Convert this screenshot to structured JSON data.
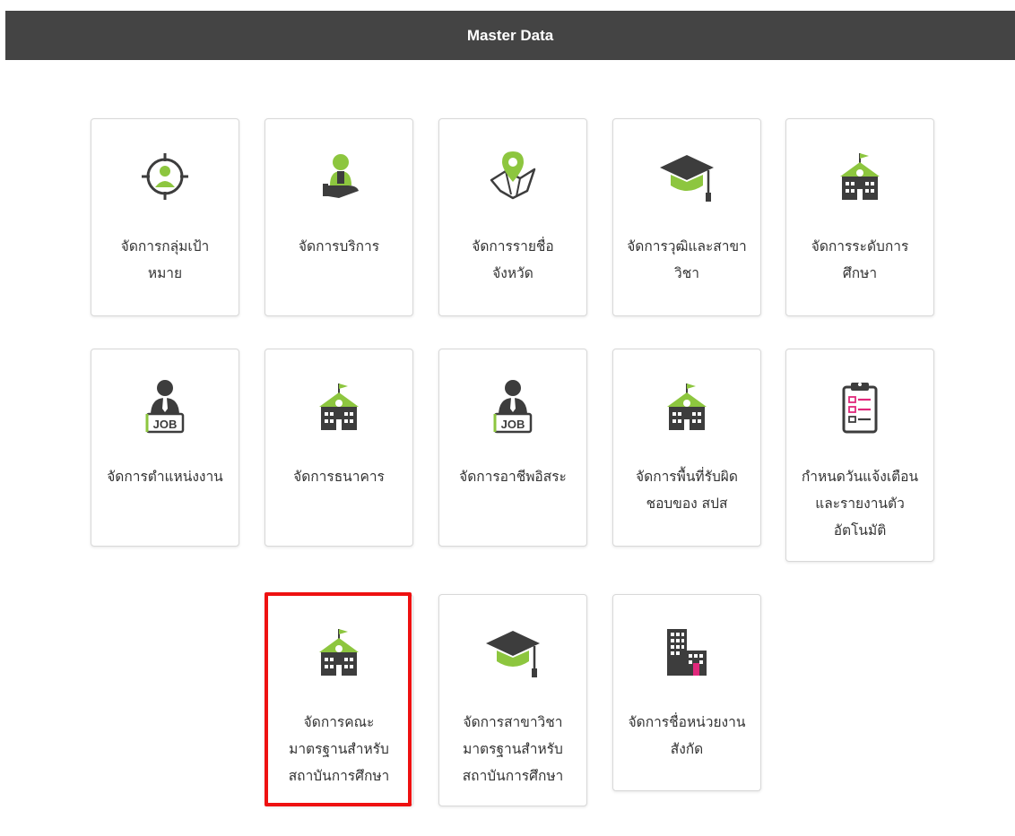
{
  "header": {
    "title": "Master Data"
  },
  "colors": {
    "accent": "#8dc63f",
    "header_bg": "#444444",
    "highlight": "#ee1111",
    "icon_dark": "#3d3d3d",
    "icon_pink": "#e0287b"
  },
  "cards": [
    {
      "label": "จัดการกลุ่มเป้า\nหมาย",
      "icon": "target-person-icon"
    },
    {
      "label": "จัดการบริการ",
      "icon": "service-person-icon"
    },
    {
      "label": "จัดการรายชื่อ\nจังหวัด",
      "icon": "map-pin-icon"
    },
    {
      "label": "จัดการวุฒิและสาขา\nวิชา",
      "icon": "graduation-cap-icon"
    },
    {
      "label": "จัดการระดับการ\nศึกษา",
      "icon": "school-building-icon"
    },
    {
      "label": "จัดการตำแหน่งงาน",
      "icon": "job-person-icon",
      "badge": "JOB"
    },
    {
      "label": "จัดการธนาคาร",
      "icon": "school-building-icon"
    },
    {
      "label": "จัดการอาชีพอิสระ",
      "icon": "job-person-icon",
      "badge": "JOB"
    },
    {
      "label": "จัดการพื้นที่รับผิด\nชอบของ สปส",
      "icon": "school-building-icon"
    },
    {
      "label": "กำหนดวันแจ้งเตือน\nและรายงานตัว\nอัตโนมัติ",
      "icon": "clipboard-checklist-icon"
    },
    {
      "label": "จัดการคณะ\nมาตรฐานสำหรับ\nสถาบันการศึกษา",
      "icon": "school-building-icon"
    },
    {
      "label": "จัดการสาขาวิชา\nมาตรฐานสำหรับ\nสถาบันการศึกษา",
      "icon": "graduation-cap-icon"
    },
    {
      "label": "จัดการชื่อหน่วยงาน\nสังกัด",
      "icon": "office-building-icon"
    }
  ]
}
